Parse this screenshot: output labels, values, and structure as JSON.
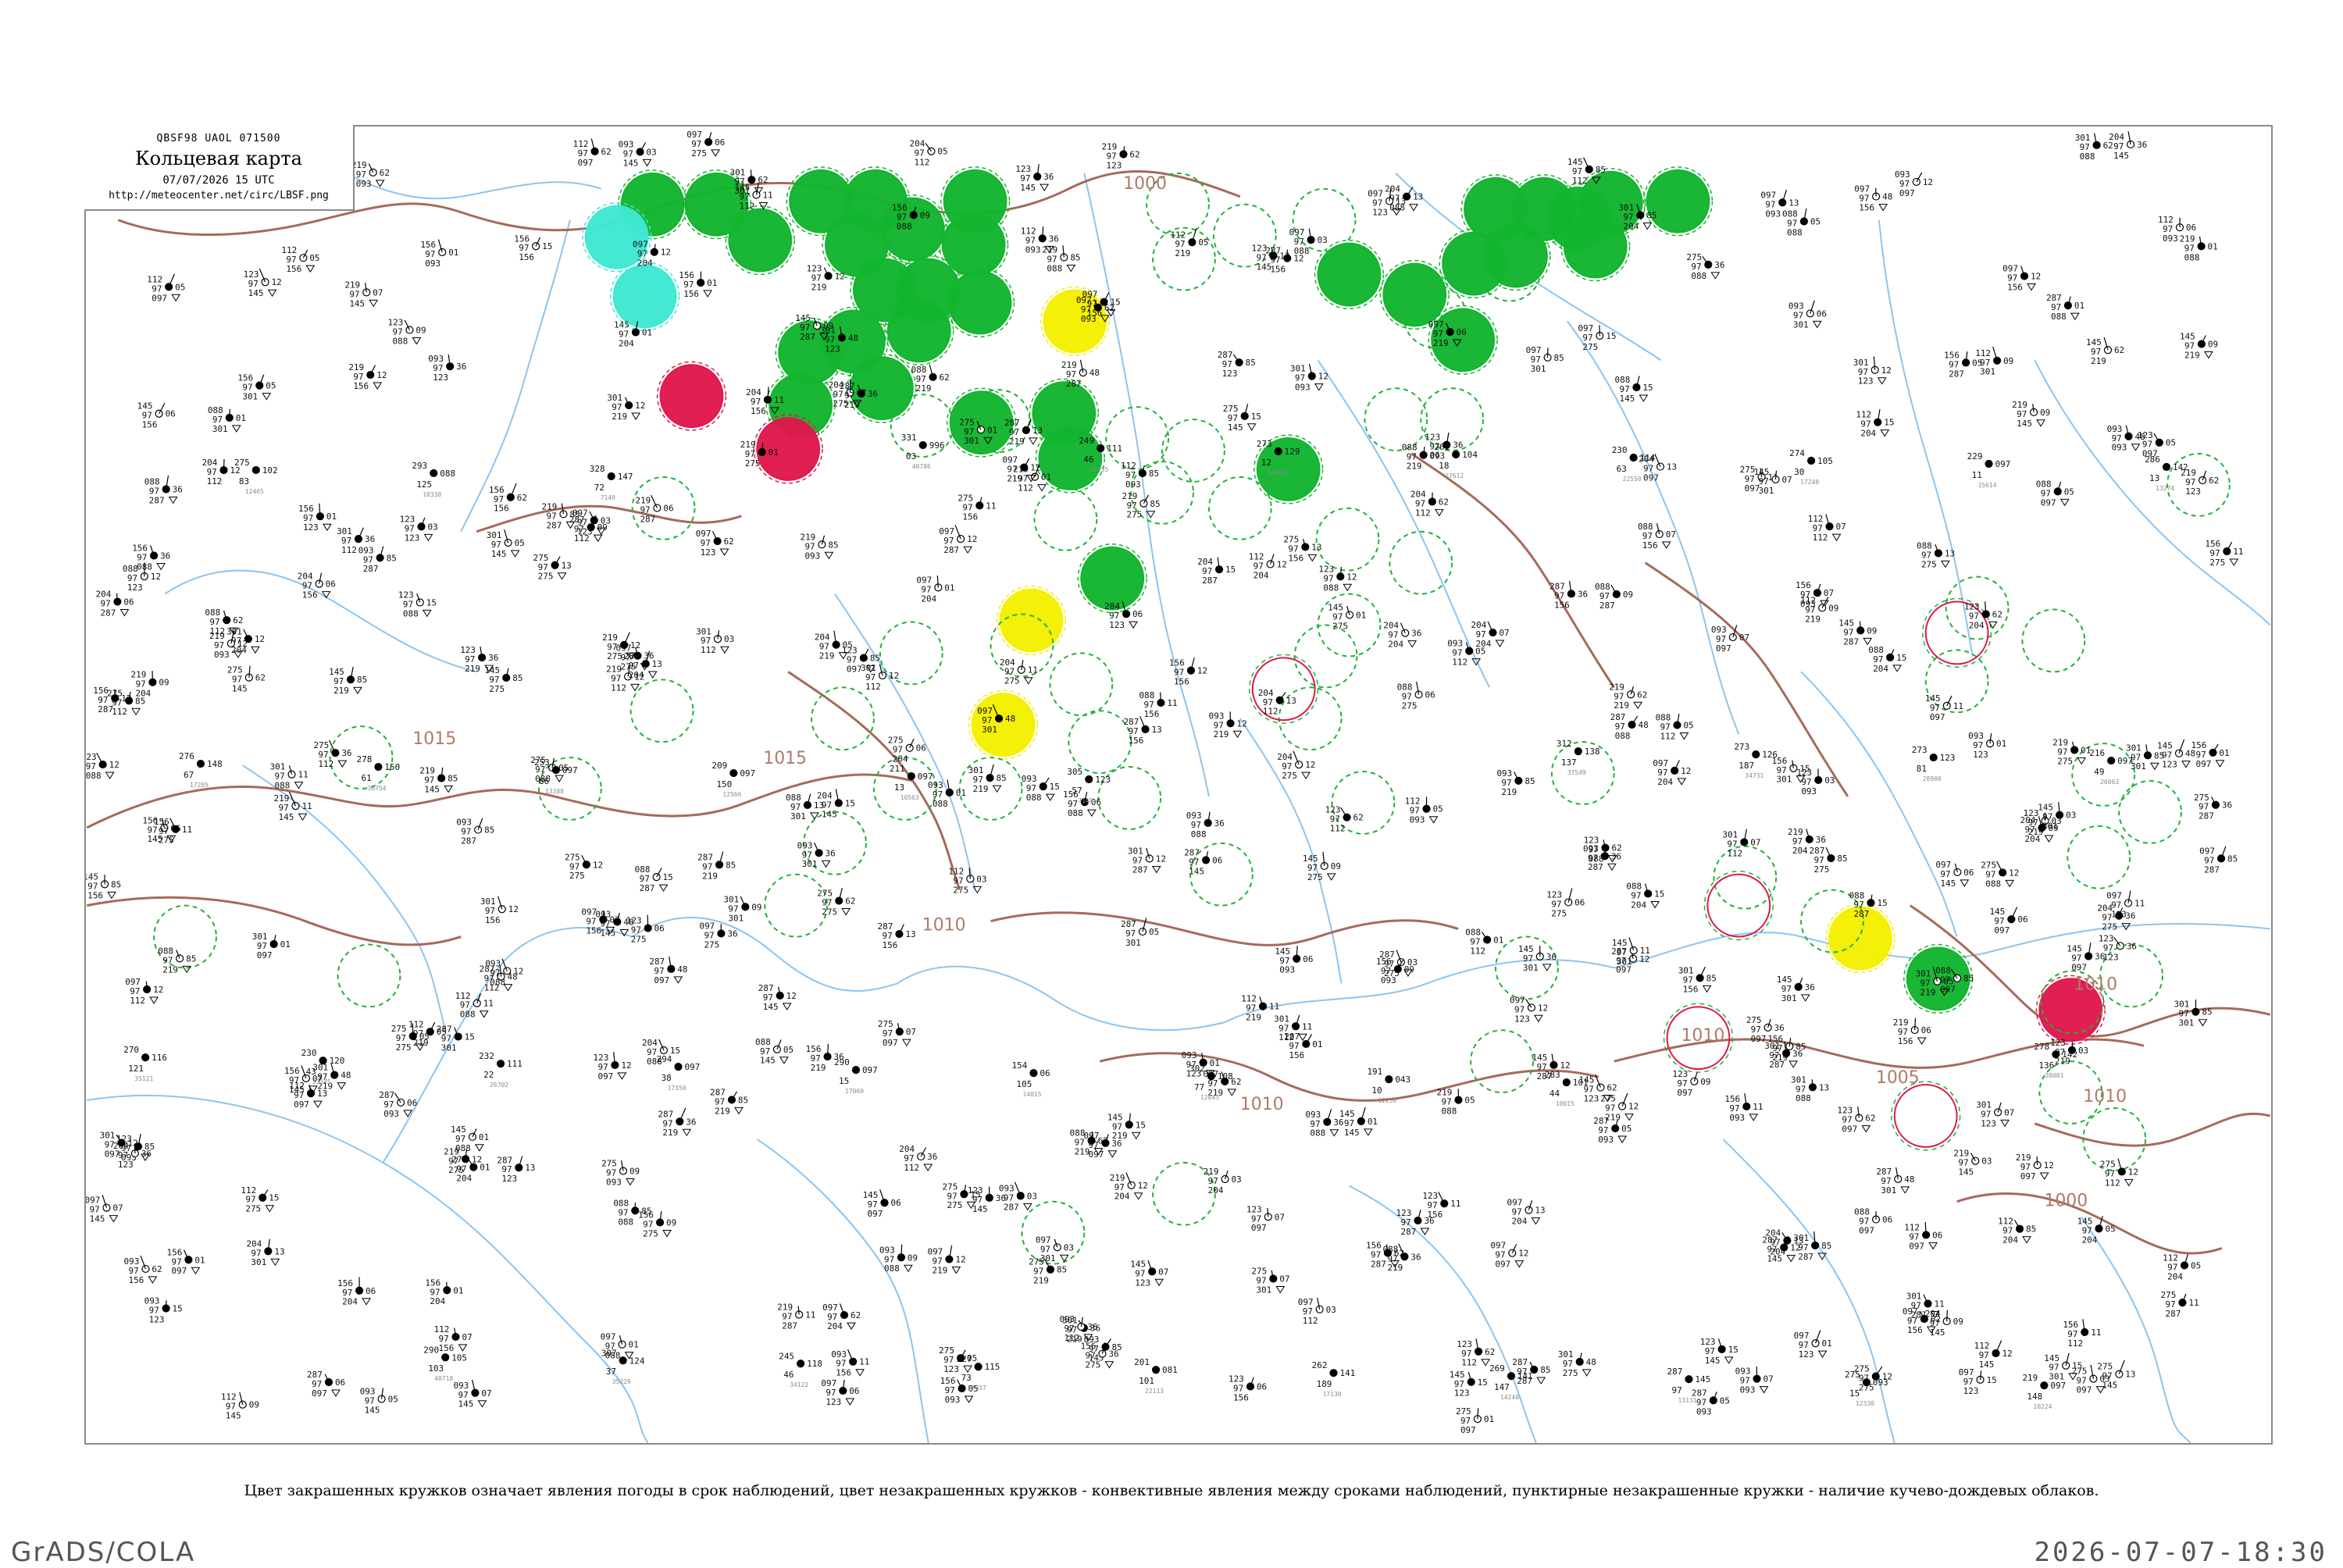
{
  "header": {
    "bulletin": "QBSF98 UAOL 071500",
    "title": "Кольцевая карта",
    "time": "07/07/2026 15 UTC",
    "url": "http://meteocenter.net/circ/LBSF.png"
  },
  "caption": "Цвет закрашенных кружков означает явления погоды в срок наблюдений, цвет незакрашенных кружков - конвективные явления между сроками наблюдений, пунктирные незакрашенные кружки - наличие кучево-дождевых облаков.",
  "footer": {
    "left": "GrADS/COLA",
    "right": "2026-07-07-18:30"
  },
  "colors": {
    "isobar": "#a66a5a",
    "river": "#8cc4f0",
    "rain": "#12b52e",
    "thunder": "#e0184c",
    "fog": "#f4f000",
    "snow": "#3ee8d2",
    "cb_dashed": "#22b03a"
  },
  "isobar_labels": [
    "1000",
    "1015",
    "1015",
    "1010",
    "1010",
    "1010",
    "1005",
    "1010",
    "1010",
    "1000"
  ],
  "stations": [
    {
      "id": "15",
      "p": "149",
      "t": "22",
      "w": "13"
    },
    {
      "id": "7149",
      "p": "328",
      "t": "147",
      "w": "72"
    },
    {
      "id": "7140",
      "p": "305",
      "t": "123",
      "w": "57"
    },
    {
      "id": "10015",
      "p": "283",
      "t": "101",
      "w": "44"
    },
    {
      "id": "10224",
      "p": "219",
      "t": "097",
      "w": "148"
    },
    {
      "id": "10338",
      "p": "293",
      "t": "088",
      "w": "125"
    },
    {
      "id": "10563",
      "p": "211",
      "t": "097",
      "w": "13"
    },
    {
      "id": "12250",
      "p": "191",
      "t": "043",
      "w": "10"
    },
    {
      "id": "12330",
      "p": "275",
      "t": "093",
      "w": "15"
    },
    {
      "id": "12465",
      "p": "275",
      "t": "102",
      "w": "83"
    },
    {
      "id": "12566",
      "p": "209",
      "t": "097",
      "w": "150"
    },
    {
      "id": "12843",
      "p": "302",
      "t": "108",
      "w": "77"
    },
    {
      "id": "13131",
      "p": "287",
      "t": "145",
      "w": "97"
    },
    {
      "id": "13274",
      "p": "286",
      "t": "142",
      "w": "13"
    },
    {
      "id": "13388",
      "p": "253",
      "t": "097",
      "w": "86"
    },
    {
      "id": "14015",
      "p": "154",
      "t": "06",
      "w": "105"
    },
    {
      "id": "14240",
      "p": "269",
      "t": "141",
      "w": "147"
    },
    {
      "id": "15614",
      "p": "229",
      "t": "097",
      "w": "11"
    },
    {
      "id": "16754",
      "p": "278",
      "t": "150",
      "w": "61"
    },
    {
      "id": "17060",
      "p": "290",
      "t": "097",
      "w": "15"
    },
    {
      "id": "17130",
      "p": "262",
      "t": "141",
      "w": "189"
    },
    {
      "id": "17240",
      "p": "274",
      "t": "105",
      "w": "30"
    },
    {
      "id": "17285",
      "p": "276",
      "t": "148",
      "w": "67"
    },
    {
      "id": "17350",
      "p": "294",
      "t": "097",
      "w": "38"
    },
    {
      "id": "22113",
      "p": "201",
      "t": "081",
      "w": "101"
    },
    {
      "id": "22550",
      "p": "230",
      "t": "114",
      "w": "63"
    },
    {
      "id": "26063",
      "p": "216",
      "t": "097",
      "w": "49"
    },
    {
      "id": "26702",
      "p": "232",
      "t": "111",
      "w": "22"
    },
    {
      "id": "27037",
      "p": "227",
      "t": "115",
      "w": "73"
    },
    {
      "id": "27612",
      "p": "261",
      "t": "104",
      "w": "18"
    },
    {
      "id": "28900",
      "p": "273",
      "t": "123",
      "w": "81"
    },
    {
      "id": "33345",
      "p": "230",
      "t": "120",
      "w": "43"
    },
    {
      "id": "34122",
      "p": "245",
      "t": "118",
      "w": "46"
    },
    {
      "id": "34560",
      "p": "273",
      "t": "129",
      "w": "12"
    },
    {
      "id": "34731",
      "p": "273",
      "t": "126",
      "w": "187"
    },
    {
      "id": "35121",
      "p": "270",
      "t": "116",
      "w": "121"
    },
    {
      "id": "35229",
      "p": "307",
      "t": "124",
      "w": "37"
    },
    {
      "id": "37235",
      "p": "249",
      "t": "111",
      "w": "46"
    },
    {
      "id": "37549",
      "p": "312",
      "t": "138",
      "w": "137"
    },
    {
      "id": "38001",
      "p": "278",
      "t": "142",
      "w": "136"
    },
    {
      "id": "40718",
      "p": "290",
      "t": "105",
      "w": "103"
    },
    {
      "id": "40786",
      "p": "331",
      "t": "996",
      "w": "03"
    }
  ]
}
